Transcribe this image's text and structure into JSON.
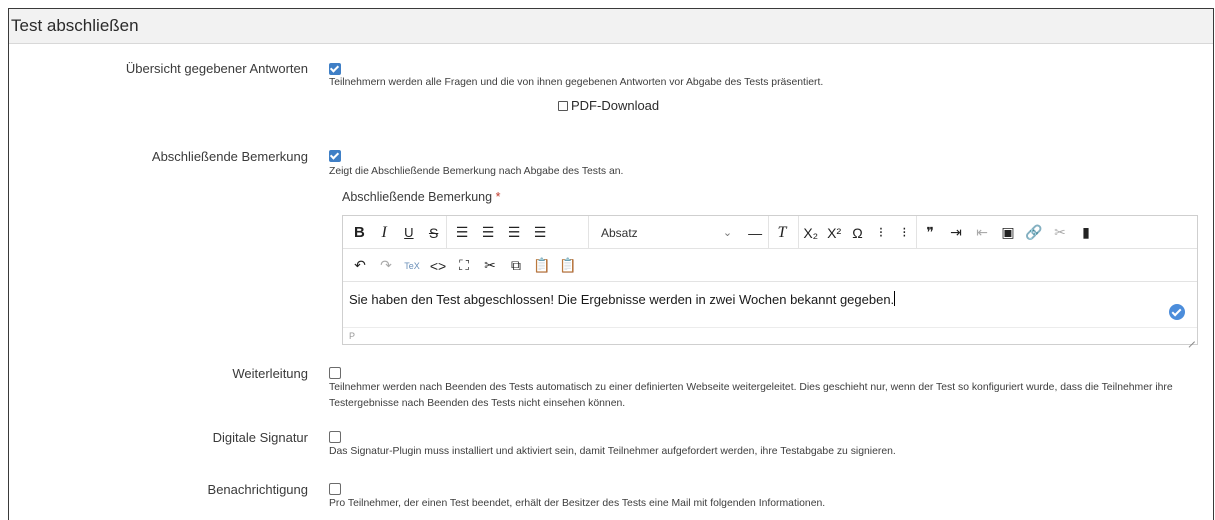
{
  "panel": {
    "title": "Test abschließen"
  },
  "overview": {
    "label": "Übersicht gegebener Antworten",
    "checked": true,
    "help": "Teilnehmern werden alle Fragen und die von ihnen gegebenen Antworten vor Abgabe des Tests präsentiert.",
    "pdf_label": "PDF-Download"
  },
  "final_remark": {
    "label": "Abschließende Bemerkung",
    "checked": true,
    "help": "Zeigt die Abschließende Bemerkung nach Abgabe des Tests an.",
    "field_label": "Abschließende Bemerkung",
    "required_mark": "*",
    "editor": {
      "format_select": "Absatz",
      "content": "Sie haben den Test abgeschlossen! Die Ergebnisse werden in zwei Wochen bekannt gegeben.",
      "status_path": "P",
      "toolbar_icons_row1": [
        "bold-icon",
        "italic-icon",
        "underline-icon",
        "strikethrough-icon",
        "align-left-icon",
        "align-center-icon",
        "align-right-icon",
        "align-justify-icon",
        "horizontal-rule-icon",
        "clear-format-icon",
        "subscript-icon",
        "superscript-icon",
        "omega-icon",
        "bullet-list-icon",
        "numbered-list-icon",
        "blockquote-icon",
        "indent-icon",
        "outdent-icon",
        "image-icon",
        "link-icon",
        "unlink-icon",
        "bookmark-icon"
      ],
      "toolbar_icons_row2": [
        "undo-icon",
        "redo-icon",
        "tex-icon",
        "code-icon",
        "fullscreen-icon",
        "cut-icon",
        "copy-icon",
        "paste-icon",
        "paste-text-icon"
      ]
    }
  },
  "redirect": {
    "label": "Weiterleitung",
    "checked": false,
    "help": "Teilnehmer werden nach Beenden des Tests automatisch zu einer definierten Webseite weitergeleitet. Dies geschieht nur, wenn der Test so konfiguriert wurde, dass die Teilnehmer ihre Testergebnisse nach Beenden des Tests nicht einsehen können."
  },
  "signature": {
    "label": "Digitale Signatur",
    "checked": false,
    "help": "Das Signatur-Plugin muss installiert und aktiviert sein, damit Teilnehmer aufgefordert werden, ihre Testabgabe zu signieren."
  },
  "notification": {
    "label": "Benachrichtigung",
    "checked": false,
    "help": "Pro Teilnehmer, der einen Test beendet, erhält der Besitzer des Tests eine Mail mit folgenden Informationen."
  },
  "colors": {
    "accent": "#3f7fc6",
    "header_bg": "#f2f2f2",
    "required": "#c0392b"
  }
}
